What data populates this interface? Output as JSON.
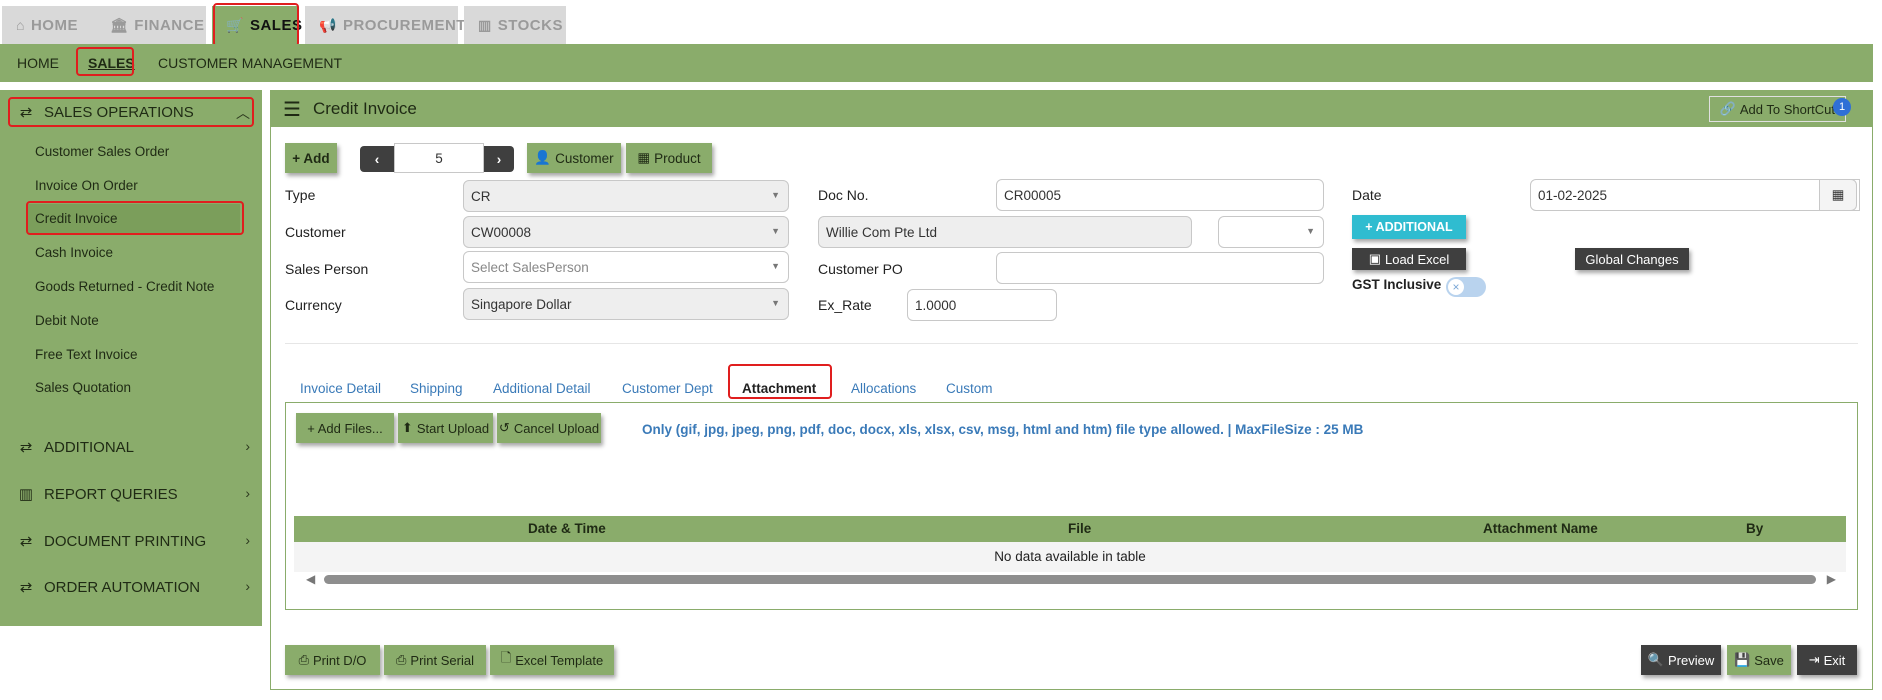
{
  "top_nav": {
    "tabs": [
      {
        "label": "HOME",
        "icon": "home-icon"
      },
      {
        "label": "FINANCE",
        "icon": "bank-icon"
      },
      {
        "label": "SALES",
        "icon": "cart-icon",
        "active": true
      },
      {
        "label": "PROCUREMENT",
        "icon": "bullhorn-icon"
      },
      {
        "label": "STOCKS",
        "icon": "bar-chart-icon"
      }
    ]
  },
  "sub_nav": {
    "items": [
      {
        "label": "HOME"
      },
      {
        "label": "SALES",
        "active": true
      },
      {
        "label": "CUSTOMER MANAGEMENT"
      }
    ]
  },
  "sidebar": {
    "sales_operations": "SALES OPERATIONS",
    "links": [
      "Customer Sales Order",
      "Invoice On Order",
      "Credit Invoice",
      "Cash Invoice",
      "Goods Returned - Credit Note",
      "Debit Note",
      "Free Text Invoice",
      "Sales Quotation"
    ],
    "active_link": "Credit Invoice",
    "sections": [
      "ADDITIONAL",
      "REPORT QUERIES",
      "DOCUMENT PRINTING",
      "ORDER AUTOMATION"
    ]
  },
  "header": {
    "title": "Credit Invoice",
    "shortcut_label": "Add To ShortCut",
    "shortcut_badge": "1"
  },
  "toolbar": {
    "add": "+ Add",
    "record_number": "5",
    "customer": "Customer",
    "product": "Product"
  },
  "form": {
    "type_label": "Type",
    "type_value": "CR",
    "customer_label": "Customer",
    "customer_value": "CW00008",
    "sales_person_label": "Sales Person",
    "sales_person_placeholder": "Select SalesPerson",
    "currency_label": "Currency",
    "currency_value": "Singapore Dollar",
    "doc_no_label": "Doc No.",
    "doc_no_value": "CR00005",
    "customer_name_value": "Willie Com Pte Ltd",
    "customer_po_label": "Customer PO",
    "customer_po_value": "",
    "ex_rate_label": "Ex_Rate",
    "ex_rate_value": "1.0000",
    "date_label": "Date",
    "date_value": "01-02-2025",
    "additional_button": "+ ADDITIONAL",
    "load_excel_button": "Load Excel",
    "global_changes_button": "Global Changes",
    "gst_inclusive_label": "GST Inclusive",
    "gst_inclusive_on": false
  },
  "tabs": [
    "Invoice Detail",
    "Shipping",
    "Additional Detail",
    "Customer Dept",
    "Attachment",
    "Allocations",
    "Custom"
  ],
  "active_tab": "Attachment",
  "attachment": {
    "add_files": "+ Add Files...",
    "start_upload": "Start Upload",
    "cancel_upload": "Cancel Upload",
    "note": "Only (gif, jpg, jpeg, png, pdf, doc, docx, xls, xlsx, csv, msg, html and htm) file type allowed. | MaxFileSize : 25 MB",
    "columns": [
      "Date & Time",
      "File",
      "Attachment Name",
      "By"
    ],
    "empty_message": "No data available in table"
  },
  "footer": {
    "print_do": "Print D/O",
    "print_serial": "Print Serial",
    "excel_template": "Excel Template",
    "preview": "Preview",
    "save": "Save",
    "exit": "Exit"
  },
  "colors": {
    "primary_green": "#8aac6b",
    "highlight_red": "#e01e1e",
    "link_blue": "#3a7ab8",
    "teal": "#2fbcd0",
    "dark_button": "#3f3f3f"
  }
}
